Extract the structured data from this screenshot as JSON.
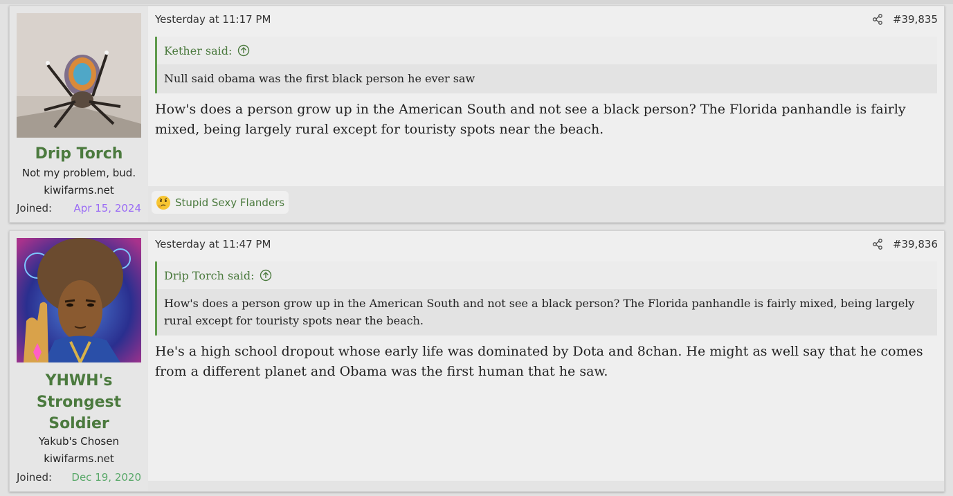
{
  "posts": [
    {
      "author": {
        "name": "Drip Torch",
        "title": "Not my problem, bud.",
        "site": "kiwifarms.net",
        "joined_label": "Joined:",
        "joined_date": "Apr 15, 2024",
        "avatar": "peacock-spider-avatar"
      },
      "date": "Yesterday at 11:17 PM",
      "number": "#39,835",
      "quote": {
        "author": "Kether said:",
        "text": "Null said obama was the first black person he ever saw"
      },
      "message": "How's does a person grow up in the American South and not see a black person? The Florida panhandle is fairly mixed, being largely rural except for touristy spots near the beach.",
      "reaction": {
        "icon": "thinking-emoji-icon",
        "label": "Stupid Sexy Flanders"
      }
    },
    {
      "author": {
        "name": "YHWH's Strongest Soldier",
        "title": "Yakub's Chosen",
        "site": "kiwifarms.net",
        "joined_label": "Joined:",
        "joined_date": "Dec 19, 2020",
        "avatar": "cosmic-figure-avatar"
      },
      "date": "Yesterday at 11:47 PM",
      "number": "#39,836",
      "quote": {
        "author": "Drip Torch said:",
        "text": "How's does a person grow up in the American South and not see a black person? The Florida panhandle is fairly mixed, being largely rural except for touristy spots near the beach."
      },
      "message": "He's a high school dropout whose early life was dominated by Dota and 8chan. He might as well say that he comes from a different planet and Obama was the first human that he saw."
    }
  ],
  "colors": {
    "username": "#4b7a3e",
    "quote_border": "#5f9a4c",
    "joined_date_1": "#9a6cf5",
    "joined_date_2": "#59a869"
  }
}
